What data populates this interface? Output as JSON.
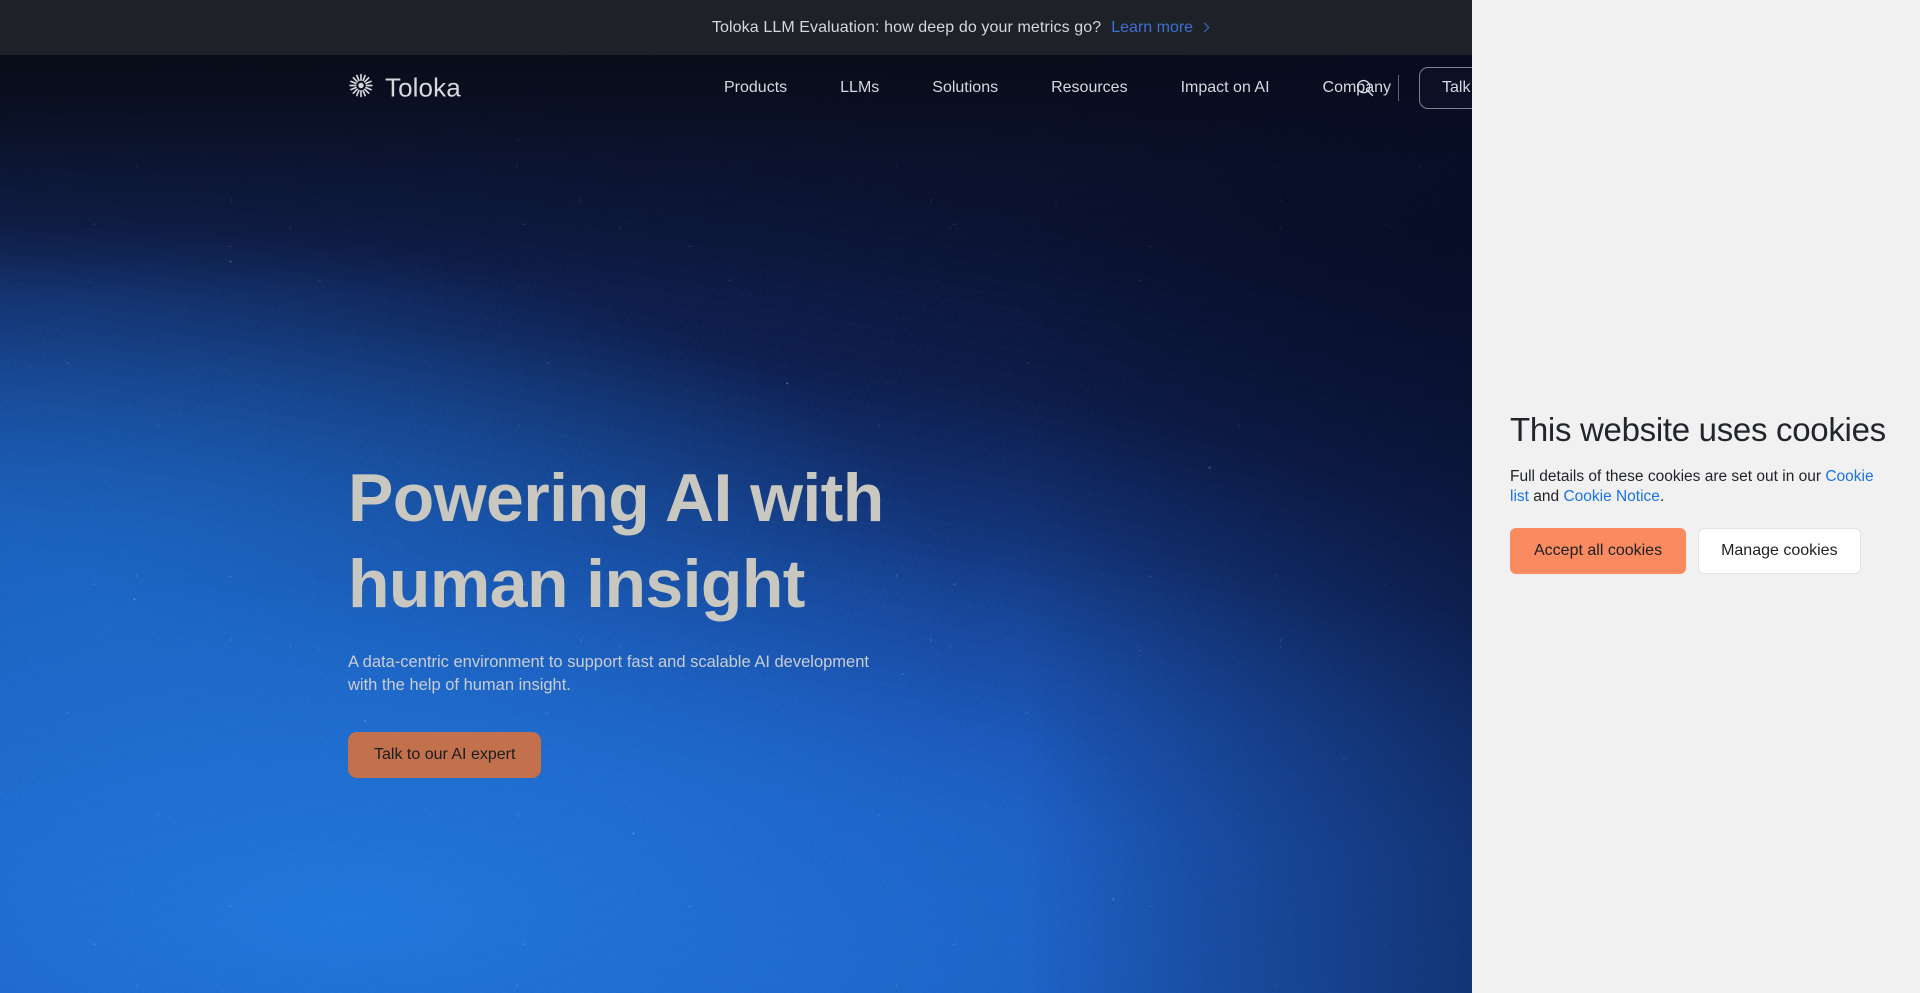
{
  "announcement": {
    "text": "Toloka LLM Evaluation: how deep do your metrics go?",
    "link_label": "Learn more",
    "chevron_icon": "chevron-right-icon"
  },
  "header": {
    "brand": {
      "icon": "toloka-sunburst-logo-icon",
      "wordmark": "Toloka"
    },
    "nav_items": [
      {
        "label": "Products"
      },
      {
        "label": "LLMs"
      },
      {
        "label": "Solutions"
      },
      {
        "label": "Resources"
      },
      {
        "label": "Impact on AI"
      },
      {
        "label": "Company"
      }
    ],
    "search_icon": "search-icon",
    "cta_label": "Talk to our AI expert"
  },
  "hero": {
    "title": "Powering AI with human insight",
    "subtitle": "A data-centric environment to support fast and scalable AI development with the help of human insight.",
    "cta_label": "Talk to our AI expert"
  },
  "cookie_panel": {
    "title": "This website uses cookies",
    "body_prefix": "Full details of these cookies are set out in our ",
    "link_cookie_list": "Cookie list",
    "body_middle": " and ",
    "link_cookie_notice": "Cookie Notice",
    "body_suffix": ".",
    "accept_label": "Accept all cookies",
    "manage_label": "Manage cookies"
  },
  "colors": {
    "accent_orange": "#fa8a5f",
    "hero_cta_orange": "#c2714c",
    "link_blue": "#1a73e8",
    "announce_link_blue": "#3f6fd0",
    "panel_background": "#f1f1f1",
    "announce_background": "#1e2127"
  }
}
